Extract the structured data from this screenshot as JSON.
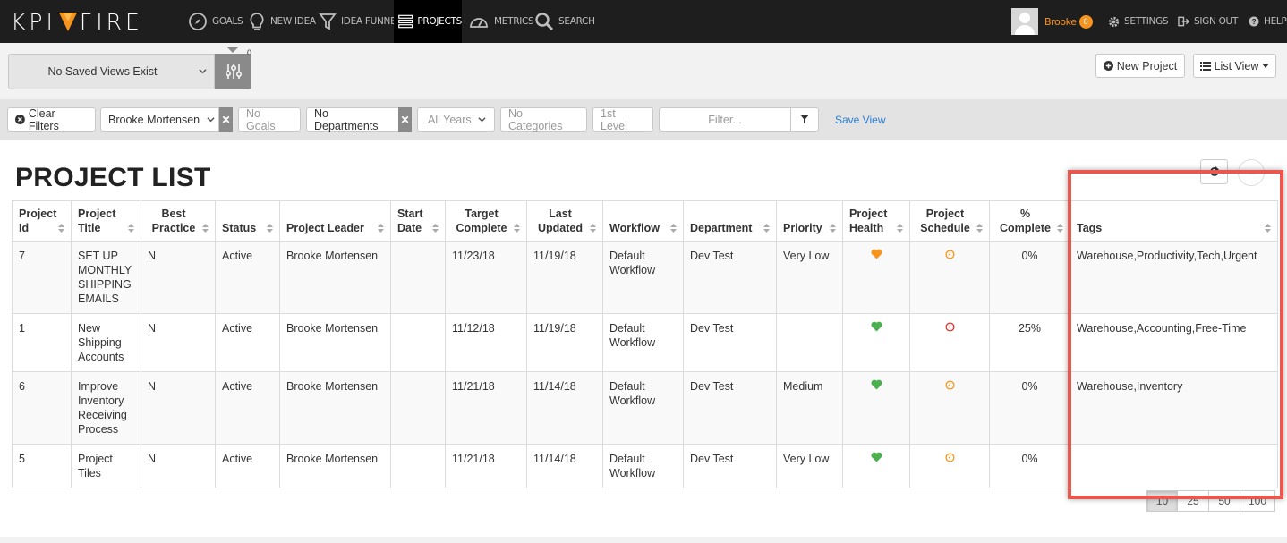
{
  "brand": {
    "name_left": "KPI",
    "name_right": "FIRE",
    "accent": "#f7941d"
  },
  "nav": {
    "items": [
      {
        "label": "GOALS",
        "icon": "compass-icon"
      },
      {
        "label": "NEW IDEA",
        "icon": "lightbulb-icon"
      },
      {
        "label": "IDEA FUNNEL",
        "icon": "funnel-icon"
      },
      {
        "label": "PROJECTS",
        "icon": "projects-icon"
      },
      {
        "label": "METRICS",
        "icon": "speedometer-icon"
      },
      {
        "label": "SEARCH",
        "icon": "search-icon"
      }
    ],
    "user": {
      "name": "Brooke",
      "badge": "6"
    },
    "settings": "SETTINGS",
    "sign_out": "SIGN OUT",
    "help": "HELP"
  },
  "views": {
    "saved_views": "No Saved Views Exist",
    "filter_count": "0",
    "new_project": "New Project",
    "list_view": "List View"
  },
  "filters": {
    "clear": "Clear Filters",
    "leader": "Brooke Mortensen",
    "goals": "No Goals",
    "departments": "No Departments",
    "years": "All Years",
    "categories": "No Categories",
    "level": "1st Level",
    "filter_placeholder": "Filter...",
    "save_view": "Save View"
  },
  "page_title": "PROJECT LIST",
  "table": {
    "headers": {
      "id": "Project Id",
      "title": "Project Title",
      "best_practice": "Best Practice",
      "status": "Status",
      "leader": "Project Leader",
      "start": "Start Date",
      "target": "Target Complete",
      "updated": "Last Updated",
      "workflow": "Workflow",
      "department": "Department",
      "priority": "Priority",
      "health": "Project Health",
      "schedule": "Project Schedule",
      "complete": "% Complete",
      "tags": "Tags"
    },
    "rows": [
      {
        "id": "7",
        "title": "SET UP MONTHLY SHIPPING EMAILS",
        "best_practice": "N",
        "status": "Active",
        "leader": "Brooke Mortensen",
        "start": "",
        "target": "11/23/18",
        "updated": "11/19/18",
        "workflow": "Default Workflow",
        "department": "Dev Test",
        "priority": "Very Low",
        "health": "heart-orange-icon",
        "schedule": "clock-orange-icon",
        "complete": "0%",
        "tags": "Warehouse,Productivity,Tech,Urgent"
      },
      {
        "id": "1",
        "title": "New Shipping Accounts",
        "best_practice": "N",
        "status": "Active",
        "leader": "Brooke Mortensen",
        "start": "",
        "target": "11/12/18",
        "updated": "11/19/18",
        "workflow": "Default Workflow",
        "department": "Dev Test",
        "priority": "",
        "health": "heart-green-icon",
        "schedule": "clock-red-icon",
        "complete": "25%",
        "tags": "Warehouse,Accounting,Free-Time"
      },
      {
        "id": "6",
        "title": "Improve Inventory Receiving Process",
        "best_practice": "N",
        "status": "Active",
        "leader": "Brooke Mortensen",
        "start": "",
        "target": "11/21/18",
        "updated": "11/14/18",
        "workflow": "Default Workflow",
        "department": "Dev Test",
        "priority": "Medium",
        "health": "heart-green-icon",
        "schedule": "clock-orange-icon",
        "complete": "0%",
        "tags": "Warehouse,Inventory"
      },
      {
        "id": "5",
        "title": "Project Tiles",
        "best_practice": "N",
        "status": "Active",
        "leader": "Brooke Mortensen",
        "start": "",
        "target": "11/21/18",
        "updated": "11/14/18",
        "workflow": "Default Workflow",
        "department": "Dev Test",
        "priority": "Very Low",
        "health": "heart-green-icon",
        "schedule": "clock-orange-icon",
        "complete": "0%",
        "tags": ""
      }
    ]
  },
  "pager": [
    "10",
    "25",
    "50",
    "100"
  ],
  "colors": {
    "heart_green": "#4caf50",
    "heart_orange": "#f7941d",
    "clock_orange": "#f7941d",
    "clock_red": "#d9342b",
    "link_blue": "#2a7fd4",
    "highlight": "#e8584f"
  }
}
